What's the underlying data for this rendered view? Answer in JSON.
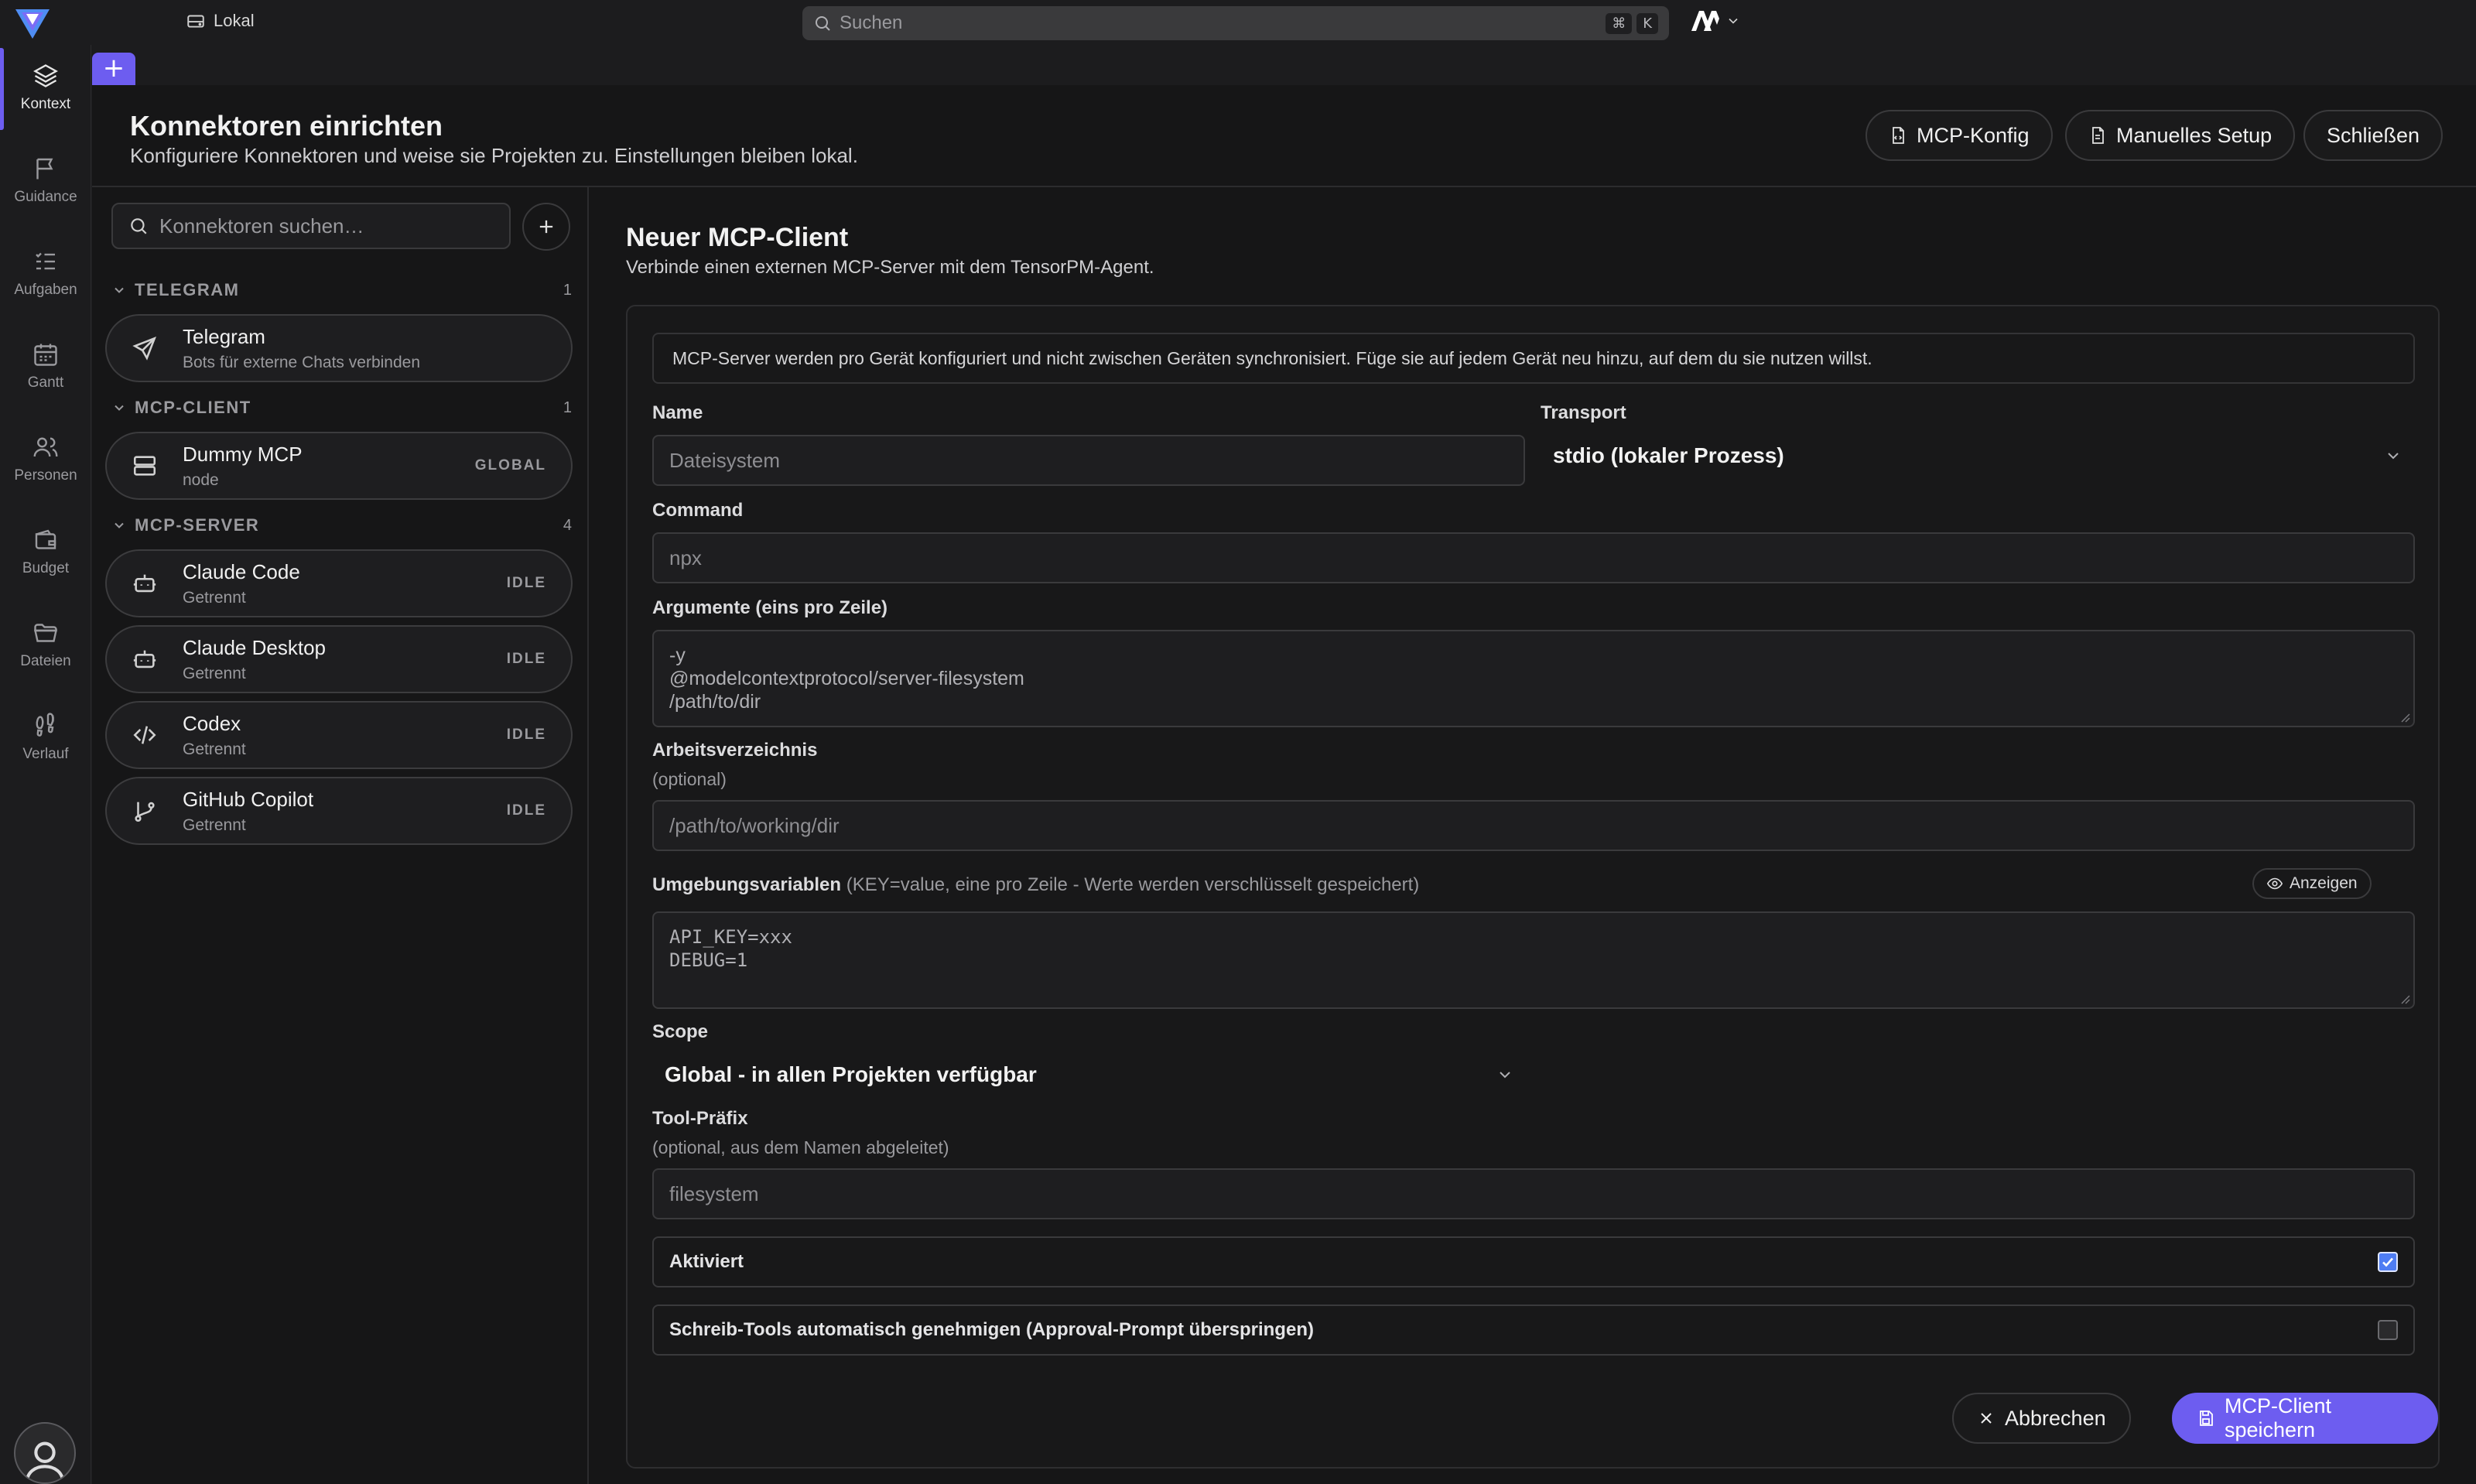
{
  "topbar": {
    "workspace_label": "Lokal",
    "search_placeholder": "Suchen",
    "shortcut_keys": [
      "⌘",
      "K"
    ],
    "brand_logo": "AI"
  },
  "rail": {
    "items": [
      {
        "label": "Kontext",
        "icon": "layers-icon",
        "active": true
      },
      {
        "label": "Guidance",
        "icon": "flag-icon"
      },
      {
        "label": "Aufgaben",
        "icon": "checklist-icon"
      },
      {
        "label": "Gantt",
        "icon": "calendar-icon"
      },
      {
        "label": "Personen",
        "icon": "users-icon"
      },
      {
        "label": "Budget",
        "icon": "wallet-icon"
      },
      {
        "label": "Dateien",
        "icon": "folder-icon"
      },
      {
        "label": "Verlauf",
        "icon": "footprints-icon"
      }
    ]
  },
  "tabs": {
    "new_tab": "+"
  },
  "header": {
    "title": "Konnektoren einrichten",
    "subtitle": "Konfiguriere Konnektoren und weise sie Projekten zu. Einstellungen bleiben lokal.",
    "buttons": {
      "mcp_config": "MCP-Konfig",
      "manual_setup": "Manuelles Setup",
      "close": "Schließen"
    }
  },
  "connectors": {
    "search_placeholder": "Konnektoren suchen…",
    "groups": [
      {
        "name": "TELEGRAM",
        "count": "1",
        "items": [
          {
            "title": "Telegram",
            "subtitle": "Bots für externe Chats verbinden",
            "badge": "",
            "icon": "send-icon"
          }
        ]
      },
      {
        "name": "MCP-CLIENT",
        "count": "1",
        "items": [
          {
            "title": "Dummy MCP",
            "subtitle": "node",
            "badge": "GLOBAL",
            "icon": "server-icon"
          }
        ]
      },
      {
        "name": "MCP-SERVER",
        "count": "4",
        "items": [
          {
            "title": "Claude Code",
            "subtitle": "Getrennt",
            "badge": "IDLE",
            "icon": "bot-icon"
          },
          {
            "title": "Claude Desktop",
            "subtitle": "Getrennt",
            "badge": "IDLE",
            "icon": "bot-icon"
          },
          {
            "title": "Codex",
            "subtitle": "Getrennt",
            "badge": "IDLE",
            "icon": "code-icon"
          },
          {
            "title": "GitHub Copilot",
            "subtitle": "Getrennt",
            "badge": "IDLE",
            "icon": "git-branch-icon"
          }
        ]
      }
    ]
  },
  "form": {
    "title": "Neuer MCP-Client",
    "subtitle": "Verbinde einen externen MCP-Server mit dem TensorPM-Agent.",
    "notice": "MCP-Server werden pro Gerät konfiguriert und nicht zwischen Geräten synchronisiert. Füge sie auf jedem Gerät neu hinzu, auf dem du sie nutzen willst.",
    "name": {
      "label": "Name",
      "placeholder": "Dateisystem"
    },
    "transport": {
      "label": "Transport",
      "value": "stdio (lokaler Prozess)"
    },
    "command": {
      "label": "Command",
      "placeholder": "npx"
    },
    "arguments": {
      "label": "Argumente (eins pro Zeile)",
      "lines": [
        "-y",
        "@modelcontextprotocol/server-filesystem",
        "/path/to/dir"
      ]
    },
    "workdir": {
      "label": "Arbeitsverzeichnis",
      "hint": "(optional)",
      "placeholder": "/path/to/working/dir"
    },
    "env": {
      "label": "Umgebungsvariablen",
      "label_hint": "(KEY=value, eine pro Zeile - Werte werden verschlüsselt gespeichert)",
      "show_button": "Anzeigen",
      "lines": [
        "API_KEY=xxx",
        "DEBUG=1"
      ]
    },
    "scope": {
      "label": "Scope",
      "value": "Global - in allen Projekten verfügbar"
    },
    "tool_prefix": {
      "label": "Tool-Präfix",
      "hint": "(optional, aus dem Namen abgeleitet)",
      "placeholder": "filesystem"
    },
    "enabled": {
      "label": "Aktiviert",
      "checked": true
    },
    "auto_approve": {
      "label": "Schreib-Tools automatisch genehmigen (Approval-Prompt überspringen)",
      "checked": false
    },
    "buttons": {
      "cancel": "Abbrechen",
      "save": "MCP-Client speichern"
    }
  },
  "colors": {
    "accent": "#6d5df0",
    "checkbox_on": "#4f7df3",
    "background": "#161617"
  }
}
